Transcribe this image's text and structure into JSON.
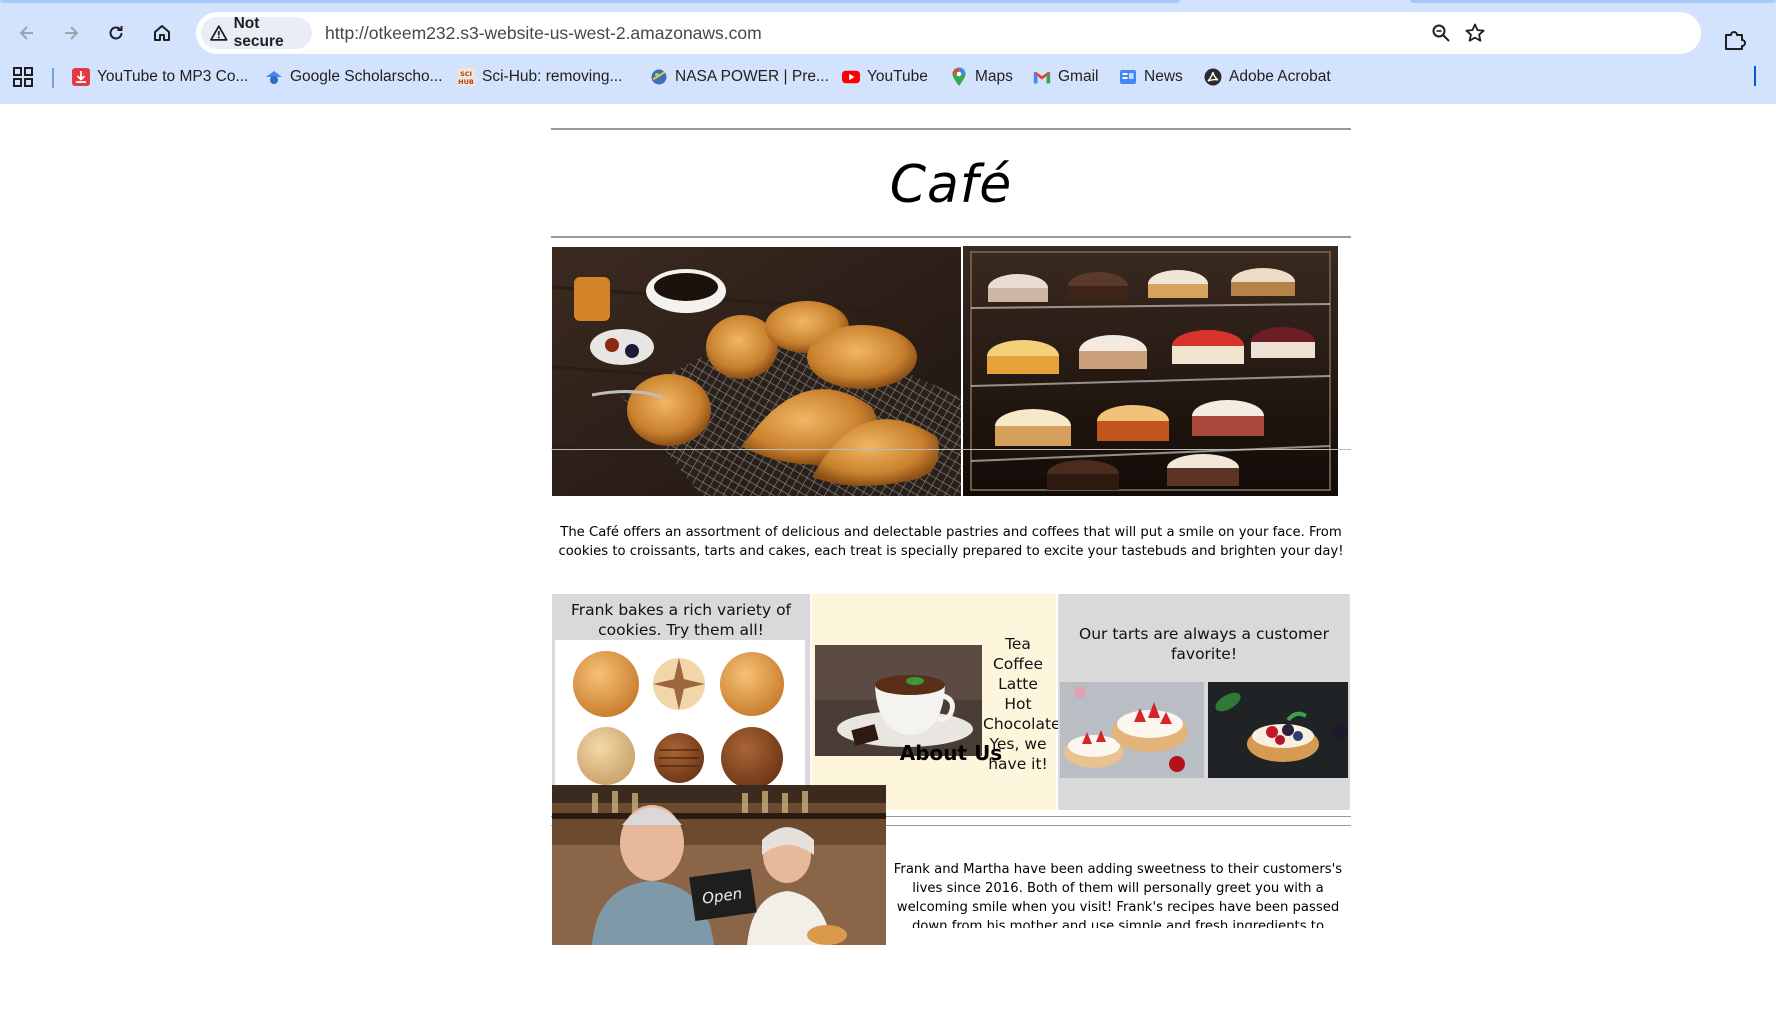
{
  "browser": {
    "url": "http://otkeem232.s3-website-us-west-2.amazonaws.com",
    "security_label": "Not secure",
    "bookmarks": [
      {
        "label": "YouTube to MP3 Co...",
        "icon": "download-icon"
      },
      {
        "label": "Google Scholarscho...",
        "icon": "scholar-icon"
      },
      {
        "label": "Sci-Hub: removing...",
        "icon": "scihub-icon"
      },
      {
        "label": "NASA POWER | Pre...",
        "icon": "nasa-icon"
      },
      {
        "label": "YouTube",
        "icon": "youtube-icon"
      },
      {
        "label": "Maps",
        "icon": "maps-icon"
      },
      {
        "label": "Gmail",
        "icon": "gmail-icon"
      },
      {
        "label": "News",
        "icon": "news-icon"
      },
      {
        "label": "Adobe Acrobat",
        "icon": "acrobat-icon"
      }
    ],
    "accent_color": "#d3e3fd"
  },
  "page": {
    "title": "Café",
    "intro": "The Café offers an assortment of delicious and delectable pastries and coffees that will put a smile on your face. From cookies to croissants, tarts and cakes, each treat is specially prepared to excite your tastebuds and brighten your day!",
    "cookies_caption": "Frank bakes a rich variety of cookies. Try them all!",
    "drinks_lines": [
      "Tea",
      "Coffee",
      "Latte",
      "Hot",
      "Chocolate",
      "Yes, we",
      "have it!"
    ],
    "tarts_caption": "Our tarts are always a customer favorite!",
    "about_title": "About Us",
    "about_text": "Frank and Martha have been adding sweetness to their customers's lives since 2016. Both of them will personally greet you with a welcoming smile when you visit! Frank's recipes have been passed down from his mother and use simple and fresh ingredients to produce delightful flavors.",
    "sign_text": "Open"
  }
}
